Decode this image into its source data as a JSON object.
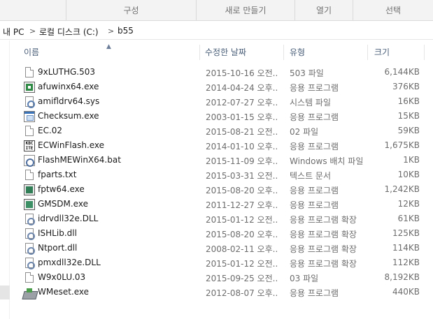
{
  "ribbon": {
    "groups": [
      "구성",
      "새로 만들기",
      "열기",
      "선택"
    ]
  },
  "address": {
    "root": "내 PC",
    "drive": "로컬 디스크 (C:)",
    "folder": "b55",
    "separator": ">"
  },
  "columns": {
    "name": "이름",
    "date": "수정한 날짜",
    "type": "유형",
    "size": "크기"
  },
  "files": [
    {
      "name": "9xLUTHG.503",
      "date": "2015-10-16 오전...",
      "type": "503 파일",
      "size": "6,144KB",
      "icon": "document-icon"
    },
    {
      "name": "afuwinx64.exe",
      "date": "2014-04-24 오후...",
      "type": "응용 프로그램",
      "size": "376KB",
      "icon": "application-icon"
    },
    {
      "name": "amifldrv64.sys",
      "date": "2012-07-27 오후...",
      "type": "시스템 파일",
      "size": "16KB",
      "icon": "system-file-icon"
    },
    {
      "name": "Checksum.exe",
      "date": "2003-01-15 오후...",
      "type": "응용 프로그램",
      "size": "15KB",
      "icon": "application-icon"
    },
    {
      "name": "EC.02",
      "date": "2015-08-21 오전...",
      "type": "02 파일",
      "size": "59KB",
      "icon": "document-icon"
    },
    {
      "name": "ECWinFlash.exe",
      "date": "2014-01-10 오후...",
      "type": "응용 프로그램",
      "size": "1,675KB",
      "icon": "kbc-app-icon"
    },
    {
      "name": "FlashMEWinX64.bat",
      "date": "2015-11-09 오후...",
      "type": "Windows 배치 파일",
      "size": "1KB",
      "icon": "batch-file-icon"
    },
    {
      "name": "fparts.txt",
      "date": "2015-03-31 오전...",
      "type": "텍스트 문서",
      "size": "10KB",
      "icon": "document-icon"
    },
    {
      "name": "fptw64.exe",
      "date": "2015-08-20 오후...",
      "type": "응용 프로그램",
      "size": "1,242KB",
      "icon": "application-icon"
    },
    {
      "name": "GMSDM.exe",
      "date": "2011-12-27 오후...",
      "type": "응용 프로그램",
      "size": "12KB",
      "icon": "application-icon"
    },
    {
      "name": "idrvdll32e.DLL",
      "date": "2015-01-12 오전...",
      "type": "응용 프로그램 확장",
      "size": "61KB",
      "icon": "dll-file-icon"
    },
    {
      "name": "ISHLib.dll",
      "date": "2015-08-20 오후...",
      "type": "응용 프로그램 확장",
      "size": "125KB",
      "icon": "dll-file-icon"
    },
    {
      "name": "Ntport.dll",
      "date": "2008-02-11 오후...",
      "type": "응용 프로그램 확장",
      "size": "114KB",
      "icon": "dll-file-icon"
    },
    {
      "name": "pmxdll32e.DLL",
      "date": "2015-01-12 오전...",
      "type": "응용 프로그램 확장",
      "size": "112KB",
      "icon": "dll-file-icon"
    },
    {
      "name": "W9x0LU.03",
      "date": "2015-09-25 오전...",
      "type": "03 파일",
      "size": "8,192KB",
      "icon": "document-icon"
    },
    {
      "name": "WMeset.exe",
      "date": "2012-08-07 오후...",
      "type": "응용 프로그램",
      "size": "440KB",
      "icon": "wmeset-app-icon"
    }
  ]
}
